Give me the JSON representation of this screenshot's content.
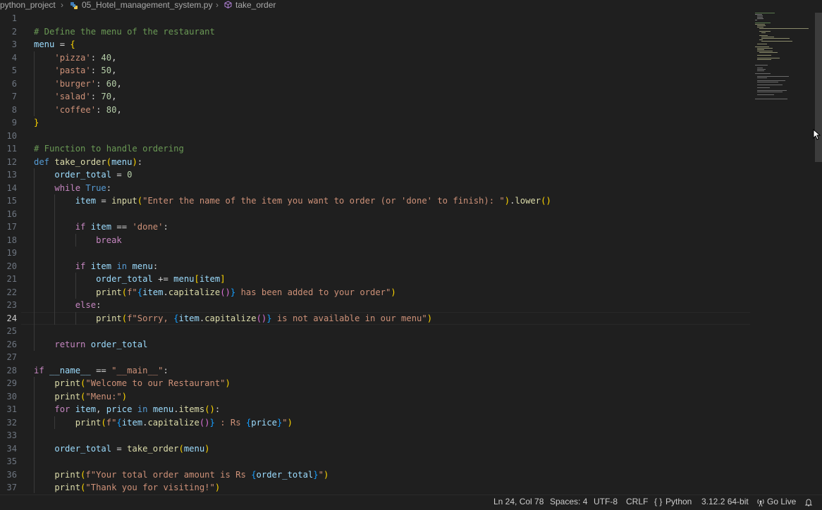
{
  "breadcrumb": {
    "folder": "python_project",
    "file": "05_Hotel_management_system.py",
    "symbol": "take_order"
  },
  "editor": {
    "cursor_line": 24,
    "lines": [
      {
        "n": "1",
        "tokens": []
      },
      {
        "n": "2",
        "tokens": [
          {
            "t": "# Define the menu of the restaurant",
            "c": "com"
          }
        ]
      },
      {
        "n": "3",
        "tokens": [
          {
            "t": "menu",
            "c": "var"
          },
          {
            "t": " = ",
            "c": "op"
          },
          {
            "t": "{",
            "c": "br1"
          }
        ]
      },
      {
        "n": "4",
        "tokens": [
          {
            "t": "    "
          },
          {
            "t": "'pizza'",
            "c": "str"
          },
          {
            "t": ": ",
            "c": "op"
          },
          {
            "t": "40",
            "c": "num"
          },
          {
            "t": ",",
            "c": "op"
          }
        ]
      },
      {
        "n": "5",
        "tokens": [
          {
            "t": "    "
          },
          {
            "t": "'pasta'",
            "c": "str"
          },
          {
            "t": ": ",
            "c": "op"
          },
          {
            "t": "50",
            "c": "num"
          },
          {
            "t": ",",
            "c": "op"
          }
        ]
      },
      {
        "n": "6",
        "tokens": [
          {
            "t": "    "
          },
          {
            "t": "'burger'",
            "c": "str"
          },
          {
            "t": ": ",
            "c": "op"
          },
          {
            "t": "60",
            "c": "num"
          },
          {
            "t": ",",
            "c": "op"
          }
        ]
      },
      {
        "n": "7",
        "tokens": [
          {
            "t": "    "
          },
          {
            "t": "'salad'",
            "c": "str"
          },
          {
            "t": ": ",
            "c": "op"
          },
          {
            "t": "70",
            "c": "num"
          },
          {
            "t": ",",
            "c": "op"
          }
        ]
      },
      {
        "n": "8",
        "tokens": [
          {
            "t": "    "
          },
          {
            "t": "'coffee'",
            "c": "str"
          },
          {
            "t": ": ",
            "c": "op"
          },
          {
            "t": "80",
            "c": "num"
          },
          {
            "t": ",",
            "c": "op"
          }
        ]
      },
      {
        "n": "9",
        "tokens": [
          {
            "t": "}",
            "c": "br1"
          }
        ]
      },
      {
        "n": "10",
        "tokens": []
      },
      {
        "n": "11",
        "tokens": [
          {
            "t": "# Function to handle ordering",
            "c": "com"
          }
        ]
      },
      {
        "n": "12",
        "tokens": [
          {
            "t": "def",
            "c": "kw"
          },
          {
            "t": " "
          },
          {
            "t": "take_order",
            "c": "fn"
          },
          {
            "t": "(",
            "c": "br1"
          },
          {
            "t": "menu",
            "c": "var"
          },
          {
            "t": ")",
            "c": "br1"
          },
          {
            "t": ":",
            "c": "op"
          }
        ]
      },
      {
        "n": "13",
        "tokens": [
          {
            "t": "    "
          },
          {
            "t": "order_total",
            "c": "var"
          },
          {
            "t": " = ",
            "c": "op"
          },
          {
            "t": "0",
            "c": "num"
          }
        ]
      },
      {
        "n": "14",
        "tokens": [
          {
            "t": "    "
          },
          {
            "t": "while",
            "c": "ctl"
          },
          {
            "t": " "
          },
          {
            "t": "True",
            "c": "kw"
          },
          {
            "t": ":",
            "c": "op"
          }
        ]
      },
      {
        "n": "15",
        "tokens": [
          {
            "t": "        "
          },
          {
            "t": "item",
            "c": "var"
          },
          {
            "t": " = ",
            "c": "op"
          },
          {
            "t": "input",
            "c": "fn"
          },
          {
            "t": "(",
            "c": "br1"
          },
          {
            "t": "\"Enter the name of the item you want to order (or 'done' to finish): \"",
            "c": "str"
          },
          {
            "t": ")",
            "c": "br1"
          },
          {
            "t": ".",
            "c": "op"
          },
          {
            "t": "lower",
            "c": "fn"
          },
          {
            "t": "()",
            "c": "br1"
          }
        ]
      },
      {
        "n": "16",
        "tokens": []
      },
      {
        "n": "17",
        "tokens": [
          {
            "t": "        "
          },
          {
            "t": "if",
            "c": "ctl"
          },
          {
            "t": " "
          },
          {
            "t": "item",
            "c": "var"
          },
          {
            "t": " == ",
            "c": "op"
          },
          {
            "t": "'done'",
            "c": "str"
          },
          {
            "t": ":",
            "c": "op"
          }
        ]
      },
      {
        "n": "18",
        "tokens": [
          {
            "t": "            "
          },
          {
            "t": "break",
            "c": "ctl"
          }
        ]
      },
      {
        "n": "19",
        "tokens": []
      },
      {
        "n": "20",
        "tokens": [
          {
            "t": "        "
          },
          {
            "t": "if",
            "c": "ctl"
          },
          {
            "t": " "
          },
          {
            "t": "item",
            "c": "var"
          },
          {
            "t": " "
          },
          {
            "t": "in",
            "c": "kw"
          },
          {
            "t": " "
          },
          {
            "t": "menu",
            "c": "var"
          },
          {
            "t": ":",
            "c": "op"
          }
        ]
      },
      {
        "n": "21",
        "tokens": [
          {
            "t": "            "
          },
          {
            "t": "order_total",
            "c": "var"
          },
          {
            "t": " += ",
            "c": "op"
          },
          {
            "t": "menu",
            "c": "var"
          },
          {
            "t": "[",
            "c": "br1"
          },
          {
            "t": "item",
            "c": "var"
          },
          {
            "t": "]",
            "c": "br1"
          }
        ]
      },
      {
        "n": "22",
        "tokens": [
          {
            "t": "            "
          },
          {
            "t": "print",
            "c": "fn"
          },
          {
            "t": "(",
            "c": "br1"
          },
          {
            "t": "f\"",
            "c": "str"
          },
          {
            "t": "{",
            "c": "br3"
          },
          {
            "t": "item",
            "c": "var"
          },
          {
            "t": ".",
            "c": "op"
          },
          {
            "t": "capitalize",
            "c": "fn"
          },
          {
            "t": "()",
            "c": "br2"
          },
          {
            "t": "}",
            "c": "br3"
          },
          {
            "t": " has been added to your order\"",
            "c": "str"
          },
          {
            "t": ")",
            "c": "br1"
          }
        ]
      },
      {
        "n": "23",
        "tokens": [
          {
            "t": "        "
          },
          {
            "t": "else",
            "c": "ctl"
          },
          {
            "t": ":",
            "c": "op"
          }
        ]
      },
      {
        "n": "24",
        "tokens": [
          {
            "t": "            "
          },
          {
            "t": "print",
            "c": "fn"
          },
          {
            "t": "(",
            "c": "br1"
          },
          {
            "t": "f\"Sorry, ",
            "c": "str"
          },
          {
            "t": "{",
            "c": "br3"
          },
          {
            "t": "item",
            "c": "var"
          },
          {
            "t": ".",
            "c": "op"
          },
          {
            "t": "capitalize",
            "c": "fn"
          },
          {
            "t": "()",
            "c": "br2"
          },
          {
            "t": "}",
            "c": "br3"
          },
          {
            "t": " is not available in our menu\"",
            "c": "str"
          },
          {
            "t": ")",
            "c": "br1"
          }
        ]
      },
      {
        "n": "25",
        "tokens": []
      },
      {
        "n": "26",
        "tokens": [
          {
            "t": "    "
          },
          {
            "t": "return",
            "c": "ctl"
          },
          {
            "t": " "
          },
          {
            "t": "order_total",
            "c": "var"
          }
        ]
      },
      {
        "n": "27",
        "tokens": []
      },
      {
        "n": "28",
        "tokens": [
          {
            "t": "if",
            "c": "ctl"
          },
          {
            "t": " "
          },
          {
            "t": "__name__",
            "c": "var"
          },
          {
            "t": " == ",
            "c": "op"
          },
          {
            "t": "\"__main__\"",
            "c": "str"
          },
          {
            "t": ":",
            "c": "op"
          }
        ]
      },
      {
        "n": "29",
        "tokens": [
          {
            "t": "    "
          },
          {
            "t": "print",
            "c": "fn"
          },
          {
            "t": "(",
            "c": "br1"
          },
          {
            "t": "\"Welcome to our Restaurant\"",
            "c": "str"
          },
          {
            "t": ")",
            "c": "br1"
          }
        ]
      },
      {
        "n": "30",
        "tokens": [
          {
            "t": "    "
          },
          {
            "t": "print",
            "c": "fn"
          },
          {
            "t": "(",
            "c": "br1"
          },
          {
            "t": "\"Menu:\"",
            "c": "str"
          },
          {
            "t": ")",
            "c": "br1"
          }
        ]
      },
      {
        "n": "31",
        "tokens": [
          {
            "t": "    "
          },
          {
            "t": "for",
            "c": "ctl"
          },
          {
            "t": " "
          },
          {
            "t": "item",
            "c": "var"
          },
          {
            "t": ", ",
            "c": "op"
          },
          {
            "t": "price",
            "c": "var"
          },
          {
            "t": " "
          },
          {
            "t": "in",
            "c": "kw"
          },
          {
            "t": " "
          },
          {
            "t": "menu",
            "c": "var"
          },
          {
            "t": ".",
            "c": "op"
          },
          {
            "t": "items",
            "c": "fn"
          },
          {
            "t": "()",
            "c": "br1"
          },
          {
            "t": ":",
            "c": "op"
          }
        ]
      },
      {
        "n": "32",
        "tokens": [
          {
            "t": "        "
          },
          {
            "t": "print",
            "c": "fn"
          },
          {
            "t": "(",
            "c": "br1"
          },
          {
            "t": "f\"",
            "c": "str"
          },
          {
            "t": "{",
            "c": "br3"
          },
          {
            "t": "item",
            "c": "var"
          },
          {
            "t": ".",
            "c": "op"
          },
          {
            "t": "capitalize",
            "c": "fn"
          },
          {
            "t": "()",
            "c": "br2"
          },
          {
            "t": "}",
            "c": "br3"
          },
          {
            "t": " : Rs ",
            "c": "str"
          },
          {
            "t": "{",
            "c": "br3"
          },
          {
            "t": "price",
            "c": "var"
          },
          {
            "t": "}",
            "c": "br3"
          },
          {
            "t": "\"",
            "c": "str"
          },
          {
            "t": ")",
            "c": "br1"
          }
        ]
      },
      {
        "n": "33",
        "tokens": []
      },
      {
        "n": "34",
        "tokens": [
          {
            "t": "    "
          },
          {
            "t": "order_total",
            "c": "var"
          },
          {
            "t": " = ",
            "c": "op"
          },
          {
            "t": "take_order",
            "c": "fn"
          },
          {
            "t": "(",
            "c": "br1"
          },
          {
            "t": "menu",
            "c": "var"
          },
          {
            "t": ")",
            "c": "br1"
          }
        ]
      },
      {
        "n": "35",
        "tokens": []
      },
      {
        "n": "36",
        "tokens": [
          {
            "t": "    "
          },
          {
            "t": "print",
            "c": "fn"
          },
          {
            "t": "(",
            "c": "br1"
          },
          {
            "t": "f\"Your total order amount is Rs ",
            "c": "str"
          },
          {
            "t": "{",
            "c": "br3"
          },
          {
            "t": "order_total",
            "c": "var"
          },
          {
            "t": "}",
            "c": "br3"
          },
          {
            "t": "\"",
            "c": "str"
          },
          {
            "t": ")",
            "c": "br1"
          }
        ]
      },
      {
        "n": "37",
        "tokens": [
          {
            "t": "    "
          },
          {
            "t": "print",
            "c": "fn"
          },
          {
            "t": "(",
            "c": "br1"
          },
          {
            "t": "\"Thank you for visiting!\"",
            "c": "str"
          },
          {
            "t": ")",
            "c": "br1"
          }
        ]
      }
    ]
  },
  "statusbar": {
    "position": "Ln 24, Col 78",
    "spaces": "Spaces: 4",
    "encoding": "UTF-8",
    "eol": "CRLF",
    "language": "Python",
    "interpreter": "3.12.2 64-bit",
    "golive": "Go Live"
  },
  "icons": {
    "python_file": "python-file-icon",
    "symbol": "method-cube-icon",
    "braces": "braces-icon",
    "golive": "radio-tower-icon",
    "bell": "bell-icon",
    "cursor": "mouse-pointer-icon"
  }
}
